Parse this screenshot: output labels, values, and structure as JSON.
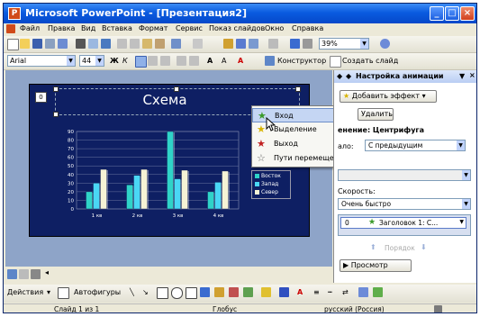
{
  "window": {
    "title": "Microsoft PowerPoint - [Презентация2]"
  },
  "menu": [
    "Файл",
    "Правка",
    "Вид",
    "Вставка",
    "Формат",
    "Сервис",
    "Показ слайдов",
    "Окно",
    "Справка"
  ],
  "toolbar": {
    "zoom": "39%",
    "font": "Arial",
    "font_size": "44",
    "designer": "Конструктор",
    "new_slide": "Создать слайд"
  },
  "slide": {
    "title": "Схема",
    "number_tag": "0"
  },
  "chart_data": {
    "type": "bar",
    "categories": [
      "1 кв",
      "2 кв",
      "3 кв",
      "4 кв"
    ],
    "ylim": [
      0,
      90
    ],
    "yticks": [
      0,
      10,
      20,
      30,
      40,
      50,
      60,
      70,
      80,
      90
    ],
    "series": [
      {
        "name": "Восток",
        "values": [
          20,
          28,
          90,
          20
        ],
        "color": "#2fd3c8"
      },
      {
        "name": "Запад",
        "values": [
          30,
          39,
          35,
          31
        ],
        "color": "#4ad7f5"
      },
      {
        "name": "Север",
        "values": [
          46,
          46,
          45,
          44
        ],
        "color": "#f6f3d5"
      }
    ]
  },
  "context_menu": {
    "items": [
      {
        "label": "Вход",
        "icon": "★",
        "color": "#3a9a2a"
      },
      {
        "label": "Выделение",
        "icon": "★",
        "color": "#d8b400"
      },
      {
        "label": "Выход",
        "icon": "★",
        "color": "#c02020"
      },
      {
        "label": "Пути перемещения",
        "icon": "☆",
        "color": "#666666"
      }
    ]
  },
  "panel": {
    "title": "Настройка анимации",
    "add_effect": "Добавить эффект",
    "delete": "Удалить",
    "change_label": "енение: Центрифуга",
    "start_label": "ало:",
    "start_value": "С предыдущим",
    "speed_label": "Скорость:",
    "speed_value": "Очень быстро",
    "list_item_num": "0",
    "list_item_text": "Заголовок 1: С...",
    "reorder": "Порядок",
    "preview": "Просмотр"
  },
  "drawing": {
    "actions": "Действия",
    "autoshapes": "Автофигуры"
  },
  "status": {
    "slide": "Слайд 1 из 1",
    "design": "Глобус",
    "lang": "русский (Россия)"
  }
}
